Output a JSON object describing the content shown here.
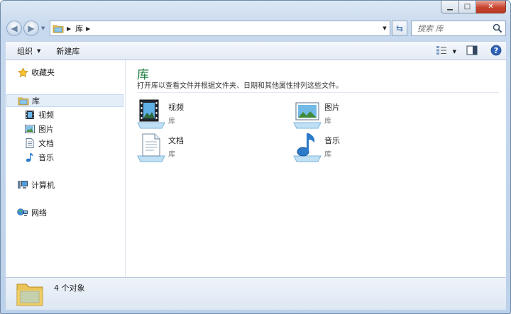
{
  "window": {
    "caption": {
      "minimize": "▁",
      "maximize": "□",
      "close": "✕"
    }
  },
  "address": {
    "crumbs": [
      "库"
    ],
    "search_placeholder": "搜索 库"
  },
  "toolbar": {
    "organize_label": "组织",
    "new_library_label": "新建库"
  },
  "sidebar": {
    "favorites": "收藏夹",
    "library": "库",
    "library_items": [
      "视频",
      "图片",
      "文档",
      "音乐"
    ],
    "computer": "计算机",
    "network": "网络"
  },
  "main": {
    "title": "库",
    "subtitle": "打开库以查看文件并根据文件夹、日期和其他属性排列这些文件。",
    "libraries": [
      {
        "name": "视频",
        "kind": "库",
        "icon": "video-library-icon"
      },
      {
        "name": "图片",
        "kind": "库",
        "icon": "pictures-library-icon"
      },
      {
        "name": "文档",
        "kind": "库",
        "icon": "documents-library-icon"
      },
      {
        "name": "音乐",
        "kind": "库",
        "icon": "music-library-icon"
      }
    ]
  },
  "details": {
    "count": "4 个对象"
  },
  "colors": {
    "title_green": "#1e7e3e",
    "selection": "#e4eef9",
    "chrome": "#c7d9ee"
  }
}
